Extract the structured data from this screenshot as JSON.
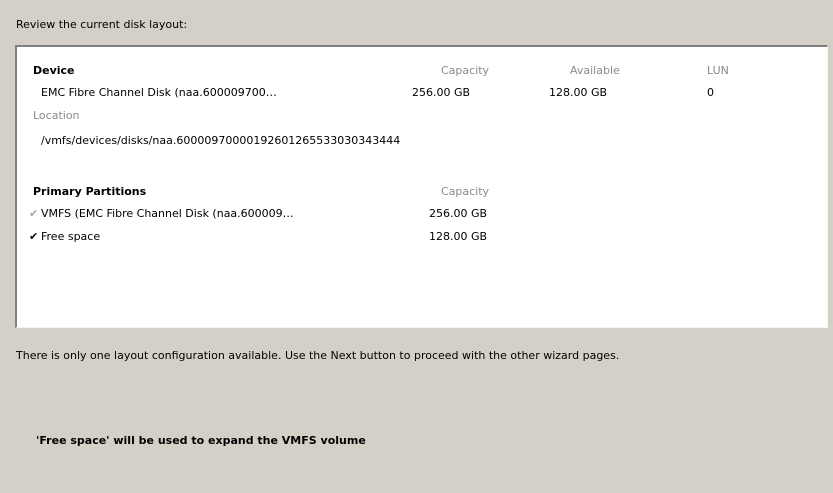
{
  "review_label": "Review the current disk layout:",
  "device_section": {
    "header_device": "Device",
    "header_capacity": "Capacity",
    "header_available": "Available",
    "header_lun": "LUN",
    "device_name": "EMC Fibre Channel Disk (naa.600009700…",
    "device_capacity": "256.00 GB",
    "device_available": "128.00 GB",
    "device_lun": "0",
    "location_label": "Location",
    "location_path": "/vmfs/devices/disks/naa.60000970000192601265533030343444"
  },
  "partitions_section": {
    "header": "Primary Partitions",
    "header_capacity": "Capacity",
    "rows": [
      {
        "name": "VMFS (EMC Fibre Channel Disk (naa.600009…",
        "capacity": "256.00 GB",
        "checked": true,
        "dim": true
      },
      {
        "name": "Free space",
        "capacity": "128.00 GB",
        "checked": true,
        "dim": false
      }
    ]
  },
  "info_text": "There is only one layout configuration available. Use the Next button to proceed with the other wizard pages.",
  "expand_note": "'Free space' will be used to expand the VMFS volume",
  "icons": {
    "check": "✔"
  }
}
